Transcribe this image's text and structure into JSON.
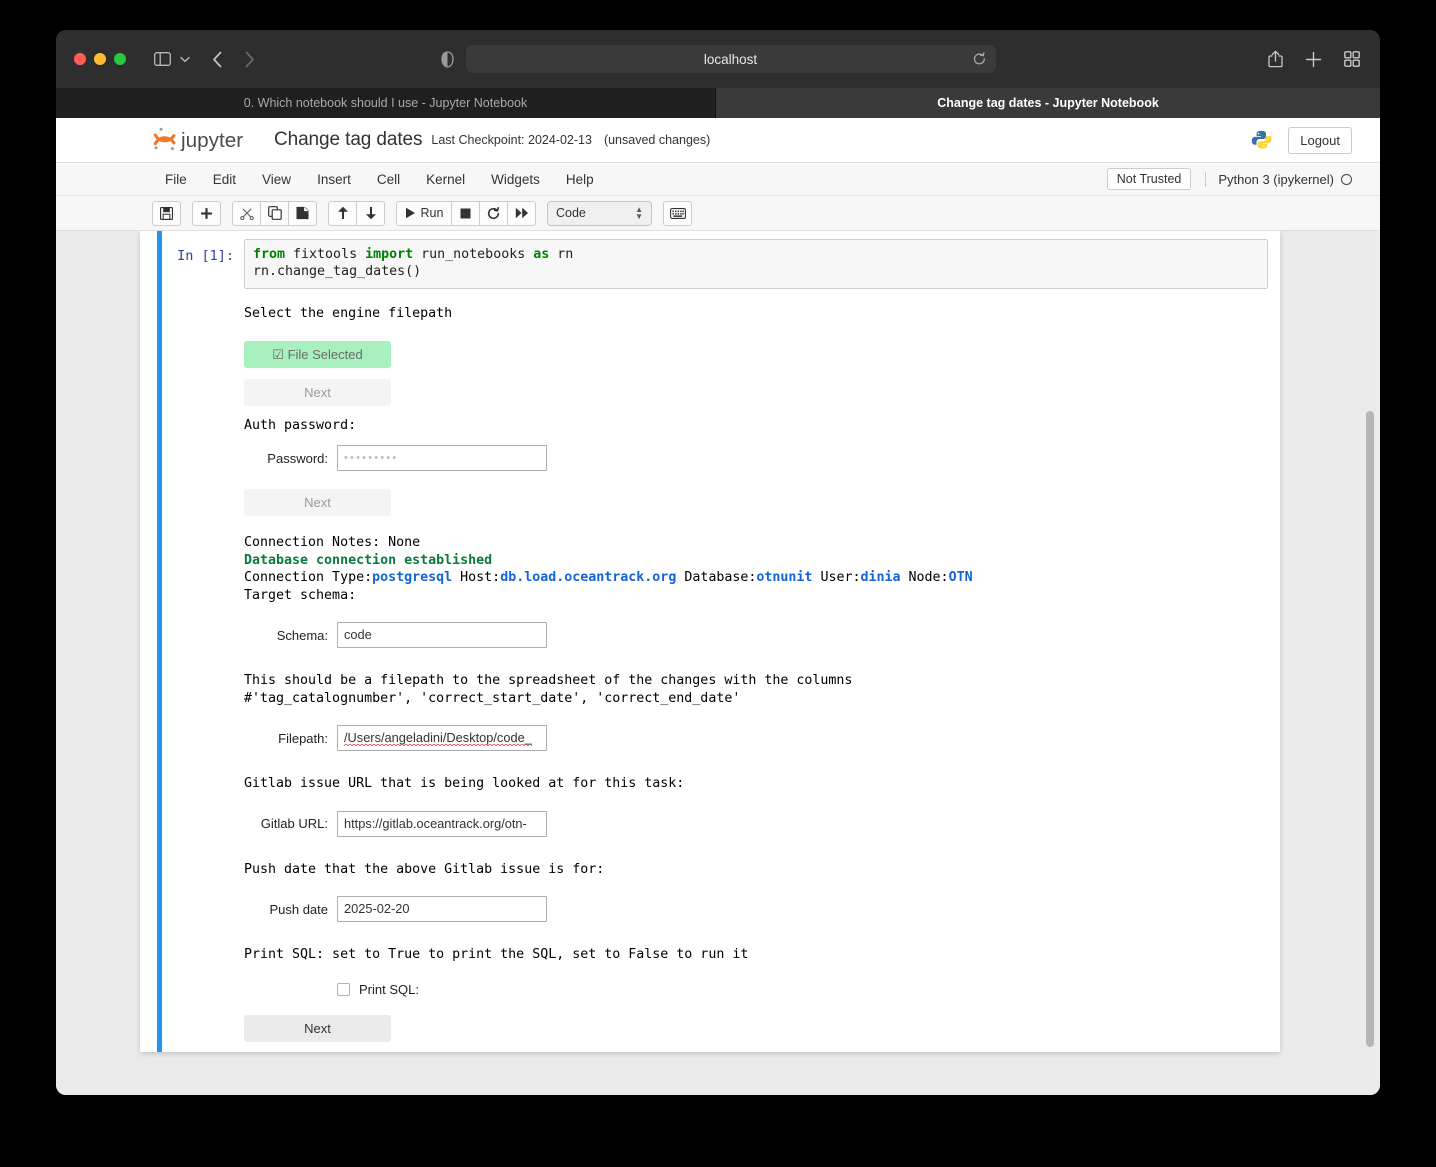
{
  "browser": {
    "address": "localhost",
    "icons": {
      "sidebar": "sidebar-toggle-icon",
      "caret": "chevron-down-icon",
      "back": "back-arrow-icon",
      "forward": "forward-arrow-icon",
      "shield": "privacy-shield-icon",
      "reload": "reload-icon",
      "share": "share-icon",
      "newtab": "plus-icon",
      "taboverview": "tab-overview-icon"
    },
    "tabs": [
      {
        "title": "0. Which notebook should I use - Jupyter Notebook",
        "active": false
      },
      {
        "title": "Change tag dates - Jupyter Notebook",
        "active": true
      }
    ]
  },
  "jupyter": {
    "logo_text": "jupyter",
    "notebook_name": "Change tag dates",
    "checkpoint": "Last Checkpoint: 2024-02-13",
    "unsaved": "(unsaved changes)",
    "logout_label": "Logout",
    "menu": [
      "File",
      "Edit",
      "View",
      "Insert",
      "Cell",
      "Kernel",
      "Widgets",
      "Help"
    ],
    "trust_status": "Not Trusted",
    "kernel_name": "Python 3 (ipykernel)",
    "toolbar": {
      "save_label": "Save and Checkpoint",
      "insert_label": "Insert cell below",
      "cut_label": "Cut",
      "copy_label": "Copy",
      "paste_label": "Paste",
      "moveup_label": "Move up",
      "movedown_label": "Move down",
      "run_label": "Run",
      "stop_label": "Interrupt kernel",
      "restart_label": "Restart kernel",
      "restart_run_all_label": "Restart and run all",
      "celltype_value": "Code",
      "keyboard_label": "Open command palette"
    }
  },
  "cell": {
    "prompt": "In [1]:",
    "code": [
      {
        "segments": [
          {
            "text": "from ",
            "kw": true
          },
          {
            "text": "fixtools ",
            "kw": false
          },
          {
            "text": "import ",
            "kw": true
          },
          {
            "text": "run_notebooks ",
            "kw": false
          },
          {
            "text": "as ",
            "kw": true
          },
          {
            "text": "rn",
            "kw": false
          }
        ]
      },
      {
        "segments": [
          {
            "text": "rn.change_tag_dates()",
            "kw": false
          }
        ]
      }
    ]
  },
  "output": {
    "engine_prompt": "Select the engine filepath",
    "file_selected_label": "File Selected",
    "next_1_label": "Next",
    "auth_prompt": "Auth password:",
    "password_label": "Password:",
    "password_value": "•••••••••",
    "next_2_label": "Next",
    "connection_notes": "Connection Notes: None",
    "connection_established": "Database connection established",
    "conn_type_label": "Connection Type:",
    "conn_type_value": "postgresql",
    "host_label": " Host:",
    "host_value": "db.load.oceantrack.org",
    "database_label": " Database:",
    "database_value": "otnunit",
    "user_label": " User:",
    "user_value": "dinia",
    "node_label": " Node:",
    "node_value": "OTN",
    "target_schema_prompt": "Target schema:",
    "schema_label": "Schema:",
    "schema_value": "code",
    "filepath_prompt_line1": "This should be a filepath to the spreadsheet of the changes with the columns",
    "filepath_prompt_line2": "#'tag_catalognumber', 'correct_start_date', 'correct_end_date'",
    "filepath_label": "Filepath:",
    "filepath_value": "/Users/angeladini/Desktop/code_",
    "gitlab_prompt": "Gitlab issue URL that is being looked at for this task:",
    "gitlab_label": "Gitlab URL:",
    "gitlab_value": "https://gitlab.oceantrack.org/otn-",
    "pushdate_prompt": "Push date that the above Gitlab issue is for:",
    "pushdate_label": "Push date",
    "pushdate_value": "2025-02-20",
    "printsql_prompt": "Print SQL: set to True to print the SQL, set to False to run it",
    "printsql_label": "Print SQL:",
    "next_3_label": "Next"
  },
  "colors": {
    "accent_blue": "#2196f3",
    "green_success": "#0a7a3d",
    "link_blue": "#1464d8",
    "file_selected_bg": "#a8f0bd"
  }
}
